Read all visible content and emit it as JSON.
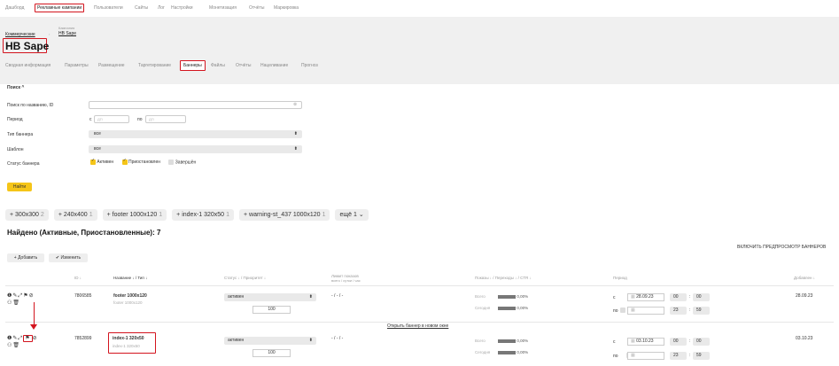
{
  "topnav": {
    "items": [
      "Дашборд",
      "Рекламные кампании",
      "Пользователи",
      "Сайты",
      "Лог",
      "Настройки",
      "Монетизация",
      "Отчёты",
      "Маркировка"
    ],
    "active_index": 1
  },
  "breadcrumb": {
    "parent": "Коммерческие",
    "campaign_caption": "Кампания",
    "campaign_name": "HB Sape"
  },
  "page_title": "HB Sape",
  "tabs": {
    "items": [
      "Сводная информация",
      "Параметры",
      "Размещение",
      "Таргетирование",
      "Баннеры",
      "Файлы",
      "Отчёты",
      "Нацеливание",
      "Прогноз"
    ],
    "active_index": 4
  },
  "search": {
    "toggle_label": "Поиск ^",
    "name_id_label": "Поиск по названию, ID",
    "period_label": "Период",
    "period_from": "с",
    "period_to": "по",
    "date_placeholder": "ДП",
    "type_label": "Тип баннера",
    "type_value": "все",
    "template_label": "Шаблон",
    "template_value": "все",
    "status_label": "Статус баннера",
    "status_options": [
      "Активен",
      "Приостановлен",
      "Завершён"
    ],
    "status_checked": [
      true,
      true,
      false
    ],
    "find_button": "Найти"
  },
  "chips": [
    {
      "label": "+ 300x300",
      "count": "2"
    },
    {
      "label": "+ 240x400",
      "count": "1"
    },
    {
      "label": "+ footer 1000x120",
      "count": "1"
    },
    {
      "label": "+ index-1 320x50",
      "count": "1"
    },
    {
      "label": "+ warning-st_437 1000x120",
      "count": "1"
    },
    {
      "label": "ещё 1 ⌄",
      "count": ""
    }
  ],
  "found_text": "Найдено (Активные, Приостановленные): 7",
  "preview_toggle": "ВКЛЮЧИТЬ ПРЕДПРОСМОТР БАННЕРОВ",
  "actions": {
    "add": "+ Добавить",
    "edit": "✔ Изменить"
  },
  "table": {
    "headers": {
      "id": "ID ↓",
      "name": "Название ↓ / Тип ↓",
      "status": "Статус ↓ / Приоритет ↓",
      "limit": "Лимит показов",
      "limit_sub": "всего / сутки / час",
      "stats": "Показы ↓ / Переходы ↓ / CTR ↓",
      "period": "Период",
      "added": "Добавлен ↓"
    },
    "rows": [
      {
        "id": "7806585",
        "name": "footer 1000x120",
        "type": "footer 1000x120",
        "status": "активен",
        "priority": "100",
        "limit": "- / - / -",
        "total_label": "Всего",
        "total_ctr": "0,00%",
        "today_label": "Сегодня",
        "today_ctr": "0,00%",
        "from_label": "с",
        "from_date": "28.09.23",
        "from_h": "00",
        "from_m": "00",
        "to_label": "по",
        "to_h": "23",
        "to_m": "59",
        "added": "28.09.23"
      },
      {
        "id": "7852899",
        "name": "index-1 320x50",
        "type": "index-1 320x50",
        "status": "активен",
        "priority": "100",
        "limit": "- / - / -",
        "total_label": "Всего",
        "total_ctr": "0,00%",
        "today_label": "Сегодня",
        "today_ctr": "0,00%",
        "from_label": "с",
        "from_date": "03.10.23",
        "from_h": "00",
        "from_m": "00",
        "to_label": "по",
        "to_h": "23",
        "to_m": "59",
        "added": "03.10.23"
      }
    ],
    "open_new_window_link": "Открыть баннер в новом окне"
  },
  "colors": {
    "accent_yellow": "#f5c518",
    "highlight_red": "#d3141e",
    "band_grey": "#f0f0f0"
  }
}
